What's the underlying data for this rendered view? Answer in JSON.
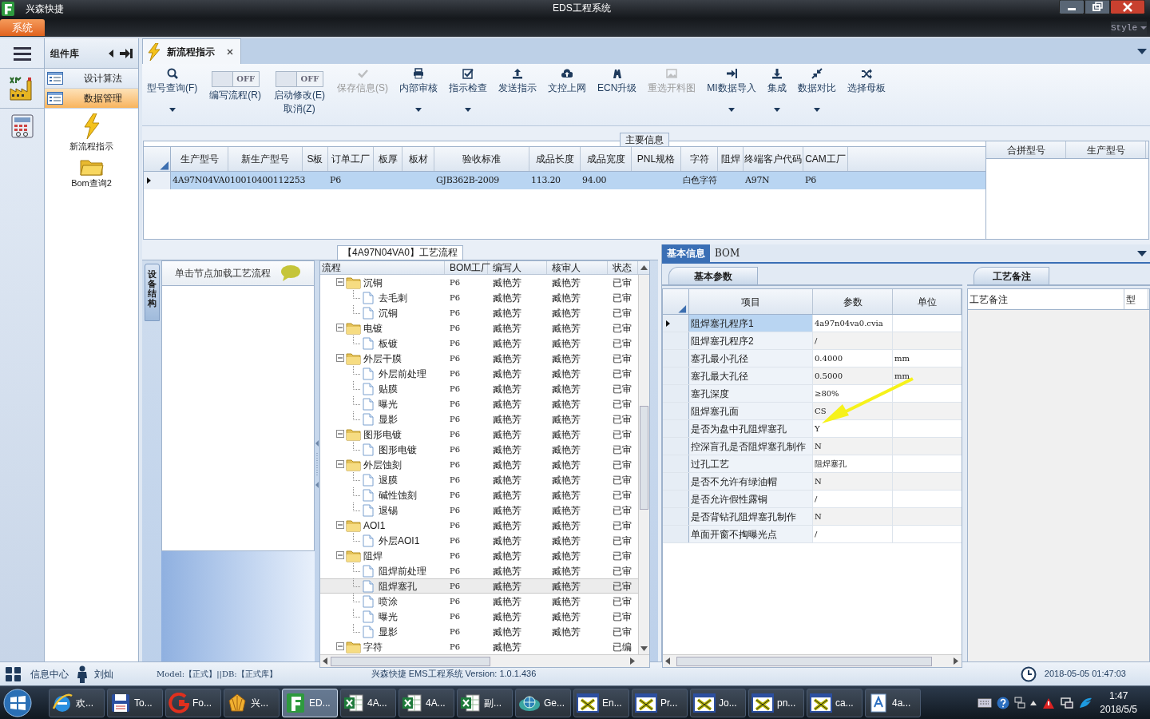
{
  "window": {
    "app_name": "兴森快捷",
    "title": "EDS工程系统",
    "menu_tab": "系统",
    "style_menu": "Style"
  },
  "component_panel": {
    "title": "组件库",
    "items": [
      {
        "label": "设计算法",
        "selected": false
      },
      {
        "label": "数据管理",
        "selected": true
      }
    ],
    "shortcuts": [
      {
        "label": "新流程指示",
        "kind": "lightning"
      },
      {
        "label": "Bom查询2",
        "kind": "folder"
      }
    ]
  },
  "document_tabs": [
    {
      "label": "新流程指示",
      "selected": true
    }
  ],
  "toolbar": [
    {
      "kind": "button",
      "label": "型号查询(F)",
      "dropdown": true,
      "disabled": false
    },
    {
      "kind": "toggle",
      "switch_text": "OFF",
      "on": false,
      "label": "编写流程(R)"
    },
    {
      "kind": "toggle",
      "switch_text": "OFF",
      "on": false,
      "label": "启动修改(E)",
      "label2": "取消(Z)"
    },
    {
      "kind": "button",
      "label": "保存信息(S)",
      "dropdown": false,
      "disabled": true
    },
    {
      "kind": "button",
      "label": "内部审核",
      "dropdown": true,
      "disabled": false
    },
    {
      "kind": "button",
      "label": "指示检查",
      "dropdown": true,
      "disabled": false
    },
    {
      "kind": "button",
      "label": "发送指示",
      "dropdown": false,
      "disabled": false
    },
    {
      "kind": "button",
      "label": "文控上网",
      "dropdown": false,
      "disabled": false
    },
    {
      "kind": "button",
      "label": "ECN升级",
      "dropdown": false,
      "disabled": false
    },
    {
      "kind": "button",
      "label": "重选开料图",
      "dropdown": false,
      "disabled": true
    },
    {
      "kind": "button",
      "label": "MI数据导入",
      "dropdown": true,
      "disabled": false
    },
    {
      "kind": "button",
      "label": "集成",
      "dropdown": true,
      "disabled": false
    },
    {
      "kind": "button",
      "label": "数据对比",
      "dropdown": true,
      "disabled": false
    },
    {
      "kind": "button",
      "label": "选择母板",
      "dropdown": false,
      "disabled": false
    }
  ],
  "main_info": {
    "title": "主要信息",
    "columns": [
      "生产型号",
      "新生产型号",
      "S板",
      "订单工厂",
      "板厚",
      "板材",
      "验收标准",
      "成品长度",
      "成品宽度",
      "PNL规格",
      "字符",
      "阻焊",
      "终端客户代码",
      "CAM工厂"
    ],
    "rows": [
      {
        "selected": true,
        "cells": [
          "4A97N04VA0",
          "10010400112253",
          null,
          "P6",
          null,
          null,
          "GJB362B-2009",
          "113.20",
          "94.00",
          null,
          "白色字符",
          null,
          "A97N",
          "P6"
        ]
      }
    ],
    "side_columns": [
      "合拼型号",
      "生产型号"
    ]
  },
  "process": {
    "title": "【4A97N04VA0】工艺流程",
    "side_tab": "设备结构",
    "hint": "单击节点加载工艺流程",
    "columns": [
      "流程",
      "BOM工厂",
      "编写人",
      "核审人",
      "状态"
    ],
    "tree": [
      {
        "label": "沉铜",
        "bom": "P6",
        "writer": "臧艳芳",
        "reviewer": "臧艳芳",
        "status": "已审",
        "expanded": true,
        "selected": false,
        "children": [
          {
            "label": "去毛刺",
            "bom": "P6",
            "writer": "臧艳芳",
            "reviewer": "臧艳芳",
            "status": "已审",
            "selected": false
          },
          {
            "label": "沉铜",
            "bom": "P6",
            "writer": "臧艳芳",
            "reviewer": "臧艳芳",
            "status": "已审",
            "selected": false
          }
        ]
      },
      {
        "label": "电镀",
        "bom": "P6",
        "writer": "臧艳芳",
        "reviewer": "臧艳芳",
        "status": "已审",
        "expanded": true,
        "selected": false,
        "children": [
          {
            "label": "板镀",
            "bom": "P6",
            "writer": "臧艳芳",
            "reviewer": "臧艳芳",
            "status": "已审",
            "selected": false
          }
        ]
      },
      {
        "label": "外层干膜",
        "bom": "P6",
        "writer": "臧艳芳",
        "reviewer": "臧艳芳",
        "status": "已审",
        "expanded": true,
        "selected": false,
        "children": [
          {
            "label": "外层前处理",
            "bom": "P6",
            "writer": "臧艳芳",
            "reviewer": "臧艳芳",
            "status": "已审",
            "selected": false
          },
          {
            "label": "贴膜",
            "bom": "P6",
            "writer": "臧艳芳",
            "reviewer": "臧艳芳",
            "status": "已审",
            "selected": false
          },
          {
            "label": "曝光",
            "bom": "P6",
            "writer": "臧艳芳",
            "reviewer": "臧艳芳",
            "status": "已审",
            "selected": false
          },
          {
            "label": "显影",
            "bom": "P6",
            "writer": "臧艳芳",
            "reviewer": "臧艳芳",
            "status": "已审",
            "selected": false
          }
        ]
      },
      {
        "label": "图形电镀",
        "bom": "P6",
        "writer": "臧艳芳",
        "reviewer": "臧艳芳",
        "status": "已审",
        "expanded": true,
        "selected": false,
        "children": [
          {
            "label": "图形电镀",
            "bom": "P6",
            "writer": "臧艳芳",
            "reviewer": "臧艳芳",
            "status": "已审",
            "selected": false
          }
        ]
      },
      {
        "label": "外层蚀刻",
        "bom": "P6",
        "writer": "臧艳芳",
        "reviewer": "臧艳芳",
        "status": "已审",
        "expanded": true,
        "selected": false,
        "children": [
          {
            "label": "退膜",
            "bom": "P6",
            "writer": "臧艳芳",
            "reviewer": "臧艳芳",
            "status": "已审",
            "selected": false
          },
          {
            "label": "碱性蚀刻",
            "bom": "P6",
            "writer": "臧艳芳",
            "reviewer": "臧艳芳",
            "status": "已审",
            "selected": false
          },
          {
            "label": "退锡",
            "bom": "P6",
            "writer": "臧艳芳",
            "reviewer": "臧艳芳",
            "status": "已审",
            "selected": false
          }
        ]
      },
      {
        "label": "AOI1",
        "bom": "P6",
        "writer": "臧艳芳",
        "reviewer": "臧艳芳",
        "status": "已审",
        "expanded": true,
        "selected": false,
        "children": [
          {
            "label": "外层AOI1",
            "bom": "P6",
            "writer": "臧艳芳",
            "reviewer": "臧艳芳",
            "status": "已审",
            "selected": false
          }
        ]
      },
      {
        "label": "阻焊",
        "bom": "P6",
        "writer": "臧艳芳",
        "reviewer": "臧艳芳",
        "status": "已审",
        "expanded": true,
        "selected": false,
        "children": [
          {
            "label": "阻焊前处理",
            "bom": "P6",
            "writer": "臧艳芳",
            "reviewer": "臧艳芳",
            "status": "已审",
            "selected": false
          },
          {
            "label": "阻焊塞孔",
            "bom": "P6",
            "writer": "臧艳芳",
            "reviewer": "臧艳芳",
            "status": "已审",
            "selected": true
          },
          {
            "label": "喷涂",
            "bom": "P6",
            "writer": "臧艳芳",
            "reviewer": "臧艳芳",
            "status": "已审",
            "selected": false
          },
          {
            "label": "曝光",
            "bom": "P6",
            "writer": "臧艳芳",
            "reviewer": "臧艳芳",
            "status": "已审",
            "selected": false
          },
          {
            "label": "显影",
            "bom": "P6",
            "writer": "臧艳芳",
            "reviewer": "臧艳芳",
            "status": "已审",
            "selected": false
          }
        ]
      },
      {
        "label": "字符",
        "bom": "P6",
        "writer": "臧艳芳",
        "status": "已编",
        "expanded": true,
        "selected": false
      }
    ]
  },
  "detail": {
    "tabs": [
      {
        "label": "基本信息",
        "selected": true
      },
      {
        "label": "BOM",
        "selected": false
      }
    ],
    "subtab": "基本参数",
    "columns": [
      "项目",
      "参数",
      "单位"
    ],
    "rows": [
      {
        "item": "阻焊塞孔程序1",
        "value": "4a97n04va0.cvia",
        "selected": true
      },
      {
        "item": "阻焊塞孔程序2",
        "value": "/",
        "selected": false
      },
      {
        "item": "塞孔最小孔径",
        "value": "0.4000",
        "unit": "mm",
        "selected": false
      },
      {
        "item": "塞孔最大孔径",
        "value": "0.5000",
        "unit": "mm",
        "selected": false
      },
      {
        "item": "塞孔深度",
        "value": "≥80%",
        "selected": false
      },
      {
        "item": "阻焊塞孔面",
        "value": "CS",
        "selected": false
      },
      {
        "item": "是否为盘中孔阻焊塞孔",
        "value": "Y",
        "selected": false
      },
      {
        "item": "控深盲孔是否阻焊塞孔制作",
        "value": "N",
        "selected": false
      },
      {
        "item": "过孔工艺",
        "value": "阻焊塞孔",
        "selected": false
      },
      {
        "item": "是否不允许有绿油帽",
        "value": "N",
        "selected": false
      },
      {
        "item": "是否允许假性露铜",
        "value": "/",
        "selected": false
      },
      {
        "item": "是否背钻孔阻焊塞孔制作",
        "value": "N",
        "selected": false
      },
      {
        "item": "单面开窗不掏曝光点",
        "value": "/",
        "selected": false
      }
    ],
    "remarks": {
      "tab": "工艺备注",
      "columns": [
        "工艺备注",
        "型"
      ]
    }
  },
  "status_bar": {
    "info_center": "信息中心",
    "user": "刘灿",
    "environment": "Model:【正式】||DB:【正式库】",
    "version": "兴森快捷 EMS工程系统 Version: 1.0.1.436",
    "datetime": "2018-05-05 01:47:03"
  },
  "taskbar": {
    "items": [
      {
        "kind": "browser",
        "label": "欢...",
        "selected": false
      },
      {
        "kind": "disk",
        "label": "To...",
        "selected": false
      },
      {
        "kind": "reader",
        "label": "Fo...",
        "selected": false
      },
      {
        "kind": "shell",
        "label": "兴...",
        "selected": false
      },
      {
        "kind": "app",
        "label": "ED...",
        "selected": true
      },
      {
        "kind": "sheet",
        "label": "4A...",
        "selected": false
      },
      {
        "kind": "sheet",
        "label": "4A...",
        "selected": false
      },
      {
        "kind": "sheet",
        "label": "副...",
        "selected": false
      },
      {
        "kind": "globe",
        "label": "Ge...",
        "selected": false
      },
      {
        "kind": "xwin",
        "label": "En...",
        "selected": false
      },
      {
        "kind": "xwin",
        "label": "Pr...",
        "selected": false
      },
      {
        "kind": "xwin",
        "label": "Jo...",
        "selected": false
      },
      {
        "kind": "xwin",
        "label": "pn...",
        "selected": false
      },
      {
        "kind": "xwin",
        "label": "ca...",
        "selected": false
      },
      {
        "kind": "doc",
        "label": "4a...",
        "selected": false
      }
    ],
    "time": "1:47",
    "date": "2018/5/5"
  }
}
